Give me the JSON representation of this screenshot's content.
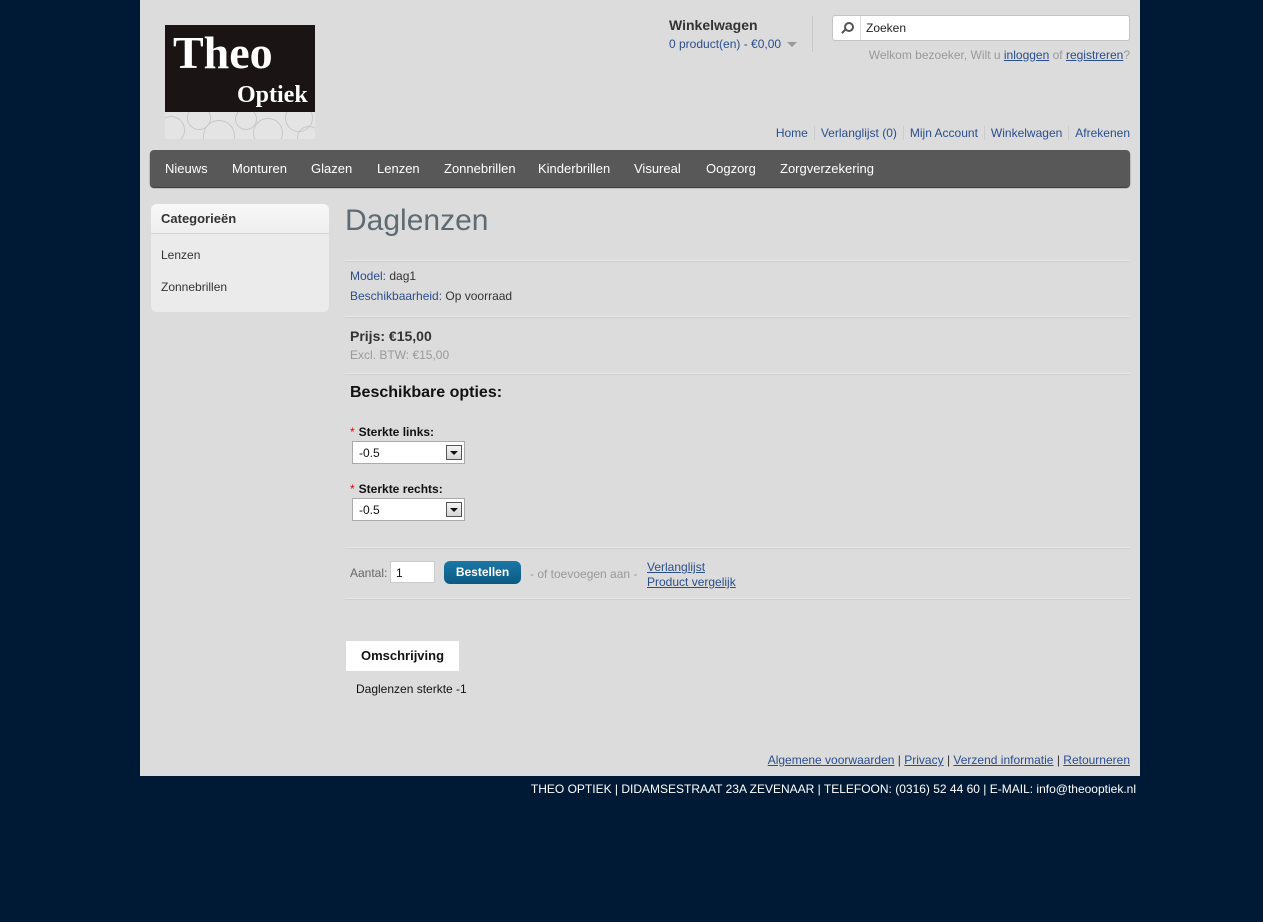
{
  "logo": {
    "line1": "Theo",
    "line2": "Optiek"
  },
  "cart": {
    "title": "Winkelwagen",
    "summary": "0 product(en) - €0,00"
  },
  "search": {
    "value": "Zoeken"
  },
  "welcome": {
    "prefix": "Welkom bezoeker, Wilt u ",
    "login": "inloggen",
    "middle": " of ",
    "register": "registreren",
    "suffix": "?"
  },
  "toplinks": [
    "Home",
    "Verlanglijst (0)",
    "Mijn Account",
    "Winkelwagen",
    "Afrekenen"
  ],
  "menu": [
    "Nieuws",
    "Monturen",
    "Glazen",
    "Lenzen",
    "Zonnebrillen",
    "Kinderbrillen",
    "Visureal",
    "Oogzorg",
    "Zorgverzekering"
  ],
  "sidebar": {
    "title": "Categorieën",
    "items": [
      "Lenzen",
      "Zonnebrillen"
    ]
  },
  "product": {
    "title": "Daglenzen",
    "model_label": "Model:",
    "model": "dag1",
    "availability_label": "Beschikbaarheid:",
    "availability": "Op voorraad",
    "price": "Prijs: €15,00",
    "price_ex": "Excl. BTW: €15,00"
  },
  "options": {
    "title": "Beschikbare opties:",
    "required_mark": "*",
    "left_label": "Sterkte links:",
    "left_value": "-0.5",
    "right_label": "Sterkte rechts:",
    "right_value": "-0.5"
  },
  "order": {
    "qty_label": "Aantal:",
    "qty": "1",
    "button": "Bestellen",
    "or_add": "- of toevoegen aan -",
    "wishlist": "Verlanglijst",
    "compare": "Product vergelijk"
  },
  "tabs": {
    "description_tab": "Omschrijving",
    "description_text": "Daglenzen sterkte -1"
  },
  "footer": {
    "links": [
      "Algemene voorwaarden",
      "Privacy",
      "Verzend informatie",
      "Retourneren"
    ],
    "separator": "|",
    "address": "THEO OPTIEK | DIDAMSESTRAAT 23A ZEVENAAR | TELEFOON: (0316) 52 44 60 | E-MAIL: info@theooptiek.nl"
  }
}
